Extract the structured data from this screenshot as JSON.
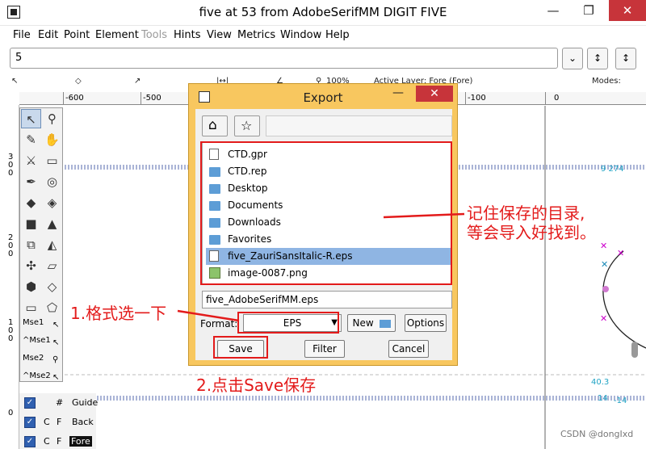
{
  "window": {
    "title": "five at 53 from AdobeSerifMM DIGIT FIVE",
    "minimize_glyph": "—",
    "restore_glyph": "❐",
    "close_glyph": "✕"
  },
  "menu": [
    "File",
    "Edit",
    "Point",
    "Element",
    "Tools",
    "Hints",
    "View",
    "Metrics",
    "Window",
    "Help"
  ],
  "glyph_input": {
    "value": "5"
  },
  "glyph_buttons": [
    "⌄",
    "↕",
    "↕"
  ],
  "infobar": {
    "zoom": "100%",
    "active_layer": "Active Layer: Fore (Fore)",
    "modes": "Modes:"
  },
  "ruler": {
    "ticks": [
      "-600",
      "-500",
      "-100",
      "0"
    ]
  },
  "vruler": {
    "labels": [
      "3\n0\n0",
      "2\n0\n0",
      "1\n0\n0",
      "0"
    ]
  },
  "tools": {
    "mse1": "Mse1",
    "cmse1": "^Mse1",
    "mse2": "Mse2",
    "cmse2": "^Mse2"
  },
  "layers": [
    {
      "check": "✓",
      "flag1": "#",
      "flag2": "",
      "name": "Guide"
    },
    {
      "check": "✓",
      "flag1": "C",
      "flag2": "F",
      "name": "Back"
    },
    {
      "check": "✓",
      "flag1": "C",
      "flag2": "F",
      "name": "Fore"
    }
  ],
  "guides": {
    "g1": "9 274",
    "g2": "40.3",
    "g3": "14",
    "g4": "-14"
  },
  "dialog": {
    "title": "Export",
    "minimize_glyph": "—",
    "close_glyph": "✕",
    "home_glyph": "⌂",
    "bookmark_glyph": "☆",
    "files": [
      {
        "name": "CTD.gpr",
        "type": "doc"
      },
      {
        "name": "CTD.rep",
        "type": "folder"
      },
      {
        "name": "Desktop",
        "type": "folder"
      },
      {
        "name": "Documents",
        "type": "folder"
      },
      {
        "name": "Downloads",
        "type": "folder"
      },
      {
        "name": "Favorites",
        "type": "folder"
      },
      {
        "name": "five_ZauriSansItalic-R.eps",
        "type": "doc"
      },
      {
        "name": "image-0087.png",
        "type": "img"
      }
    ],
    "filename": "five_AdobeSerifMM.eps",
    "format_label": "Format:",
    "format_value": "EPS",
    "new_label": "New",
    "options_label": "Options",
    "save_label": "Save",
    "filter_label": "Filter",
    "cancel_label": "Cancel"
  },
  "annotations": {
    "note1_line1": "记住保存的目录,",
    "note1_line2": "等会导入好找到。",
    "note2": "1.格式选一下",
    "note3": "2.点击Save保存"
  },
  "watermark": "CSDN @dongIxd",
  "colors": {
    "annotation": "#e31b1b",
    "dialog_frame": "#f8c75f",
    "selection": "#8fb5e3"
  }
}
